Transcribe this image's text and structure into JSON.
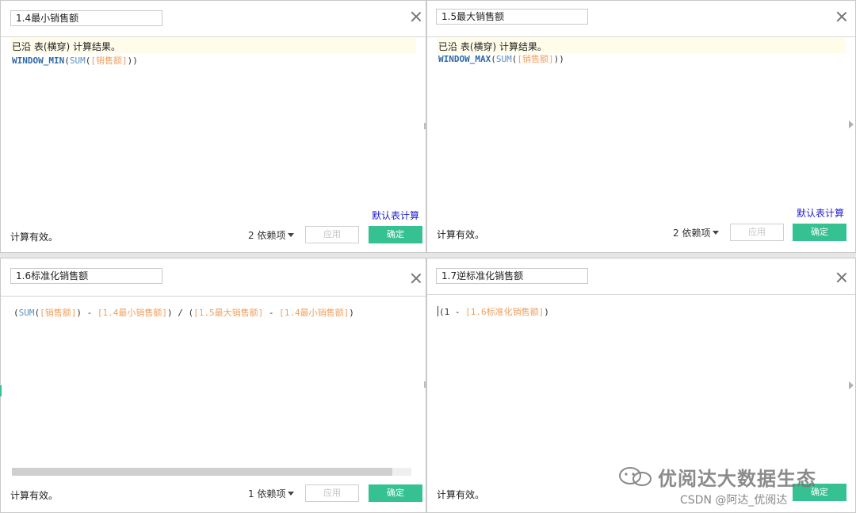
{
  "dialogs": [
    {
      "title": "1.4最小销售额",
      "info": "已沿 表(横穿) 计算结果。",
      "formula": {
        "fn": "WINDOW_MIN",
        "inner": "SUM",
        "field": "[销售额]"
      },
      "default_link": "默认表计算",
      "status": "计算有效。",
      "deps": "2 依赖项",
      "apply": "应用",
      "ok": "确定"
    },
    {
      "title": "1.5最大销售额",
      "info": "已沿 表(横穿) 计算结果。",
      "formula": {
        "fn": "WINDOW_MAX",
        "inner": "SUM",
        "field": "[销售额]"
      },
      "default_link": "默认表计算",
      "status": "计算有效。",
      "deps": "2 依赖项",
      "apply": "应用",
      "ok": "确定"
    },
    {
      "title": "1.6标准化销售额",
      "formula": {
        "inner": "SUM",
        "field": "[销售额]",
        "min_field": "[1.4最小销售额]",
        "max_field": "[1.5最大销售额]"
      },
      "status": "计算有效。",
      "deps": "1 依赖项",
      "apply": "应用",
      "ok": "确定"
    },
    {
      "title": "1.7逆标准化销售额",
      "formula": {
        "num": "1",
        "field": "[1.6标准化销售额]"
      },
      "status": "计算有效。",
      "ok": "确定"
    }
  ],
  "watermark": {
    "text": "优阅达大数据生态",
    "csdn": "CSDN @阿达_优阅达"
  },
  "colors": {
    "ok_button": "#35c191",
    "function": "#2f6aa8",
    "field": "#f0a060",
    "link": "#2020d0"
  },
  "icons": [
    "close-icon",
    "chevron-down-icon",
    "wechat-logo-icon"
  ]
}
